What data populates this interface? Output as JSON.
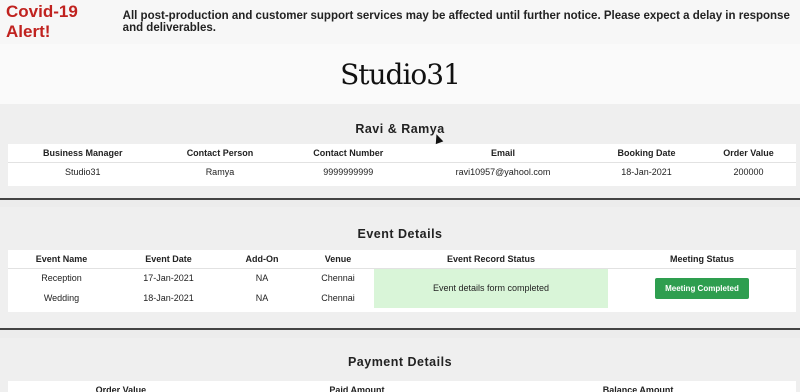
{
  "alert": {
    "title": "Covid-19 Alert!",
    "message": "All post-production and customer support services may be affected until further notice. Please expect a delay in response and deliverables."
  },
  "brand": {
    "logo_text": "Studio31"
  },
  "client": {
    "title": "Ravi & Ramya",
    "headers": [
      "Business Manager",
      "Contact Person",
      "Contact Number",
      "Email",
      "Booking Date",
      "Order Value"
    ],
    "row": [
      "Studio31",
      "Ramya",
      "9999999999",
      "ravi10957@yahool.com",
      "18-Jan-2021",
      "200000"
    ]
  },
  "events": {
    "title": "Event Details",
    "headers": [
      "Event Name",
      "Event Date",
      "Add-On",
      "Venue",
      "Event Record Status",
      "Meeting Status"
    ],
    "rows": [
      [
        "Reception",
        "17-Jan-2021",
        "NA",
        "Chennai"
      ],
      [
        "Wedding",
        "18-Jan-2021",
        "NA",
        "Chennai"
      ]
    ],
    "record_status": "Event details form completed",
    "meeting_status_button": "Meeting Completed"
  },
  "payment": {
    "title": "Payment Details",
    "headers": [
      "Order Value",
      "Paid Amount",
      "Balance Amount"
    ]
  },
  "colors": {
    "alert_red": "#c0221f",
    "status_green_bg": "#d9f5d8",
    "button_green": "#2e9e4f"
  }
}
